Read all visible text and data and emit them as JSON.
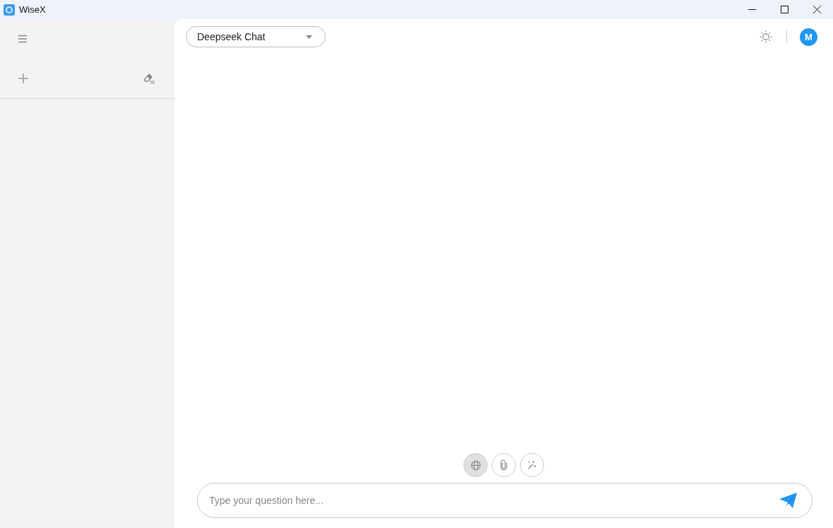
{
  "window": {
    "title": "WiseX"
  },
  "model_select": {
    "value": "Deepseek Chat"
  },
  "avatar": {
    "initial": "M"
  },
  "tools": [
    {
      "kind": "globe",
      "on": true
    },
    {
      "kind": "attach",
      "on": false
    },
    {
      "kind": "wand",
      "on": false
    }
  ],
  "input": {
    "placeholder": "Type your question here..."
  }
}
